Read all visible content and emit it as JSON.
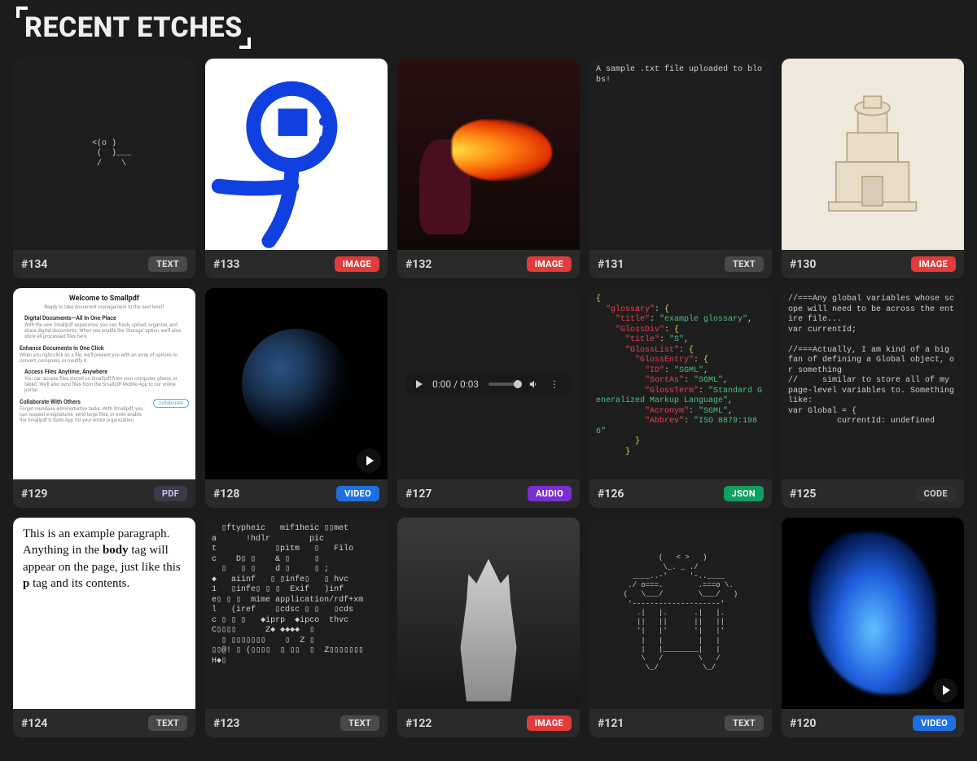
{
  "page_title": "RECENT ETCHES",
  "badge_labels": {
    "TEXT": "TEXT",
    "IMAGE": "IMAGE",
    "PDF": "PDF",
    "VIDEO": "VIDEO",
    "AUDIO": "AUDIO",
    "JSON": "JSON",
    "CODE": "CODE"
  },
  "etches": [
    {
      "id": "#134",
      "type": "TEXT",
      "text_preview": "   <(o )\n    (  )___\n    /    \\"
    },
    {
      "id": "#133",
      "type": "IMAGE",
      "image_desc": "blue-stick-figure-doodle"
    },
    {
      "id": "#132",
      "type": "IMAGE",
      "image_desc": "fire-breather-performance"
    },
    {
      "id": "#131",
      "type": "TEXT",
      "text_preview": "A sample .txt file uploaded to blobs!"
    },
    {
      "id": "#130",
      "type": "IMAGE",
      "image_desc": "paper-temple-model"
    },
    {
      "id": "#129",
      "type": "PDF",
      "pdf": {
        "title": "Welcome to Smallpdf",
        "subtitle": "Ready to take document management to the next level?",
        "sections": [
          {
            "heading": "Digital Documents—All In One Place",
            "body": "With the new Smallpdf experience, you can freely upload, organize, and share digital documents. When you enable the 'Storage' option, we'll also store all processed files here."
          },
          {
            "heading": "Enhance Documents in One Click",
            "body": "When you right-click on a file, we'll present you with an array of options to convert, compress, or modify it."
          },
          {
            "heading": "Access Files Anytime, Anywhere",
            "body": "You can access files stored on Smallpdf from your computer, phone, or tablet. We'll also sync files from the Smallpdf Mobile App to our online portal."
          },
          {
            "heading": "Collaborate With Others",
            "body": "Forget mundane administrative tasks. With Smallpdf, you can request e-signatures, send large files, or even enable the Smallpdf G Suite App for your entire organization."
          }
        ],
        "cta": "collaborate"
      }
    },
    {
      "id": "#128",
      "type": "VIDEO",
      "image_desc": "earth-from-space-night"
    },
    {
      "id": "#127",
      "type": "AUDIO",
      "audio": {
        "time": "0:00 / 0:03"
      }
    },
    {
      "id": "#126",
      "type": "JSON",
      "json_lines": [
        "{",
        "  \"glossary\": {",
        "    \"title\": \"example glossary\",",
        "    \"GlossDiv\": {",
        "      \"title\": \"S\",",
        "      \"GlossList\": {",
        "        \"GlossEntry\": {",
        "          \"ID\": \"SGML\",",
        "          \"SortAs\": \"SGML\",",
        "          \"GlossTerm\": \"Standard Generalized Markup Language\",",
        "          \"Acronym\": \"SGML\",",
        "          \"Abbrev\": \"ISO 8879:1986\"",
        "        }",
        "      }"
      ]
    },
    {
      "id": "#125",
      "type": "CODE",
      "text_preview": "//===Any global variables whose scope will need to be across the entire file...\nvar currentId;\n\n//===Actually, I am kind of a big fan of defining a Global object, or something\n//     similar to store all of my page-level variables to. Something like:\nvar Global = {\n          currentId: undefined"
    },
    {
      "id": "#124",
      "type": "TEXT",
      "html_preview": "This is an example paragraph. Anything in the body tag will appear on the page, just like this p tag and its contents."
    },
    {
      "id": "#123",
      "type": "TEXT",
      "text_preview": "  ▯ftypheic   mif1heic ▯▯met\na      !hdlr        pic\nt            ▯pitm   ▯   Filo\nc    D▯ ▯    & ▯     ▯\n  ▯   ▯ ▯    d ▯     ▯ ;\n◆   aiinf   ▯ ▯infe▯   ▯ hvc\n1   ▯infe▯ ▯ ▯  Exif   )inf\ne▯ ▯ ▯  mime application/rdf+xm\nl   (iref    ▯cdsc ▯ ▯   ▯cds\nc ▯ ▯ ▯   ◆iprp  ◆ipco  thvc\nC▯▯▯▯      Z◆ ◆◆◆◆  ▯\n  ▯ ▯▯▯▯▯▯▯    ▯  Z ▯\n▯▯@! ▯ (▯▯▯▯  ▯ ▯▯  ▯  Z▯▯▯▯▯▯▯\nH◆▯"
    },
    {
      "id": "#122",
      "type": "IMAGE",
      "image_desc": "white-fox-statue-bw"
    },
    {
      "id": "#121",
      "type": "TEXT",
      "text_preview": "        (   < >   )\n         \\_. _ ./\n  ____..-'     '-..____\n ./ o===.        .===o \\.\n(   \\___/        \\___/   )\n '--------------------'\n   .|   |.      .|   |.\n   ||   ||      ||   ||\n   '|   |'      '|   |'\n    |   |        |   |\n    |   |________|   |\n    \\   /        \\   /\n     \\_/          \\_/"
    },
    {
      "id": "#120",
      "type": "VIDEO",
      "image_desc": "blue-ink-smoke-abstract"
    }
  ]
}
